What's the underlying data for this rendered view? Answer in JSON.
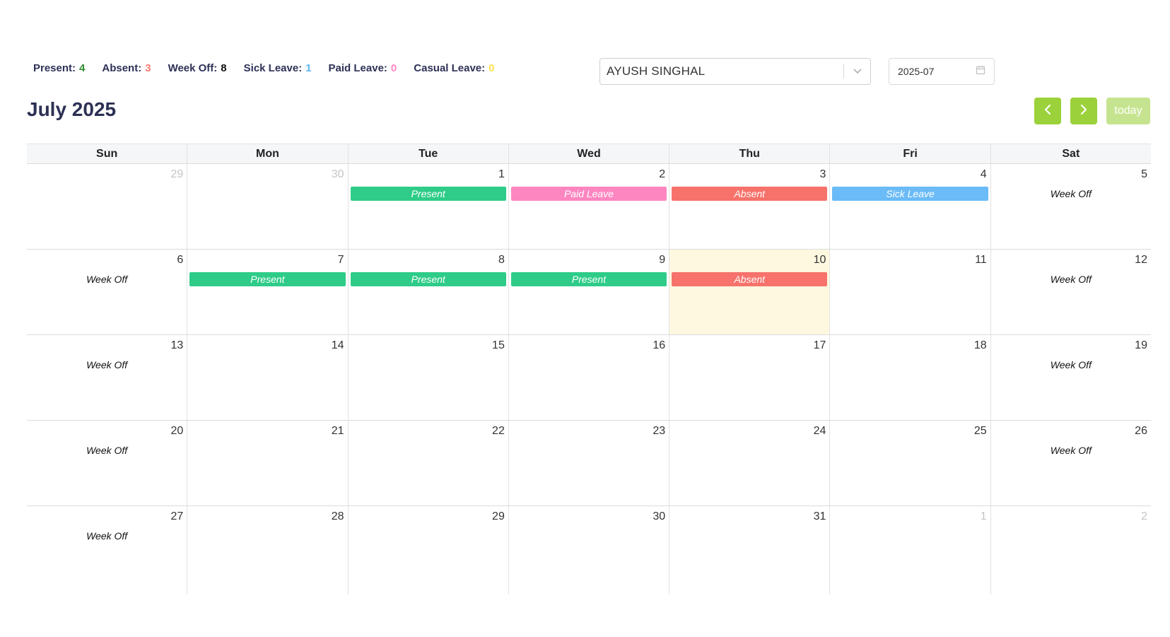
{
  "summary": [
    {
      "label": "Present:",
      "count": "4",
      "color": "#2e8b2e"
    },
    {
      "label": "Absent:",
      "count": "3",
      "color": "#f57b73"
    },
    {
      "label": "Week Off:",
      "count": "8",
      "color": "#111111"
    },
    {
      "label": "Sick Leave:",
      "count": "1",
      "color": "#5bb5f5"
    },
    {
      "label": "Paid Leave:",
      "count": "0",
      "color": "#ff86c1"
    },
    {
      "label": "Casual Leave:",
      "count": "0",
      "color": "#ffe04d"
    }
  ],
  "employee_select": {
    "value": "AYUSH SINGHAL",
    "icon": "chevron-down-icon"
  },
  "month_picker": {
    "value": "2025-07",
    "icon": "calendar-icon"
  },
  "calendar": {
    "title": "July 2025",
    "prev_icon": "chevron-left-icon",
    "next_icon": "chevron-right-icon",
    "today_label": "today",
    "accent_color": "#9bd13a",
    "today_highlight": "#fdf8df",
    "days_of_week": [
      "Sun",
      "Mon",
      "Tue",
      "Wed",
      "Thu",
      "Fri",
      "Sat"
    ],
    "event_colors": {
      "present": "#2ecc88",
      "absent": "#f7726b",
      "paid": "#fd86c1",
      "sick": "#6abbf7"
    },
    "weeks": [
      [
        {
          "num": "29",
          "other": true
        },
        {
          "num": "30",
          "other": true
        },
        {
          "num": "1",
          "event": {
            "label": "Present",
            "type": "present"
          }
        },
        {
          "num": "2",
          "event": {
            "label": "Paid Leave",
            "type": "paid"
          }
        },
        {
          "num": "3",
          "event": {
            "label": "Absent",
            "type": "absent"
          }
        },
        {
          "num": "4",
          "event": {
            "label": "Sick Leave",
            "type": "sick"
          }
        },
        {
          "num": "5",
          "event": {
            "label": "Week Off",
            "type": "weekoff"
          }
        }
      ],
      [
        {
          "num": "6",
          "event": {
            "label": "Week Off",
            "type": "weekoff"
          }
        },
        {
          "num": "7",
          "event": {
            "label": "Present",
            "type": "present"
          }
        },
        {
          "num": "8",
          "event": {
            "label": "Present",
            "type": "present"
          }
        },
        {
          "num": "9",
          "event": {
            "label": "Present",
            "type": "present"
          }
        },
        {
          "num": "10",
          "today": true,
          "event": {
            "label": "Absent",
            "type": "absent"
          }
        },
        {
          "num": "11"
        },
        {
          "num": "12",
          "event": {
            "label": "Week Off",
            "type": "weekoff"
          }
        }
      ],
      [
        {
          "num": "13",
          "event": {
            "label": "Week Off",
            "type": "weekoff"
          }
        },
        {
          "num": "14"
        },
        {
          "num": "15"
        },
        {
          "num": "16"
        },
        {
          "num": "17"
        },
        {
          "num": "18"
        },
        {
          "num": "19",
          "event": {
            "label": "Week Off",
            "type": "weekoff"
          }
        }
      ],
      [
        {
          "num": "20",
          "event": {
            "label": "Week Off",
            "type": "weekoff"
          }
        },
        {
          "num": "21"
        },
        {
          "num": "22"
        },
        {
          "num": "23"
        },
        {
          "num": "24"
        },
        {
          "num": "25"
        },
        {
          "num": "26",
          "event": {
            "label": "Week Off",
            "type": "weekoff"
          }
        }
      ],
      [
        {
          "num": "27",
          "event": {
            "label": "Week Off",
            "type": "weekoff"
          }
        },
        {
          "num": "28"
        },
        {
          "num": "29"
        },
        {
          "num": "30"
        },
        {
          "num": "31"
        },
        {
          "num": "1",
          "other": true
        },
        {
          "num": "2",
          "other": true
        }
      ]
    ]
  }
}
